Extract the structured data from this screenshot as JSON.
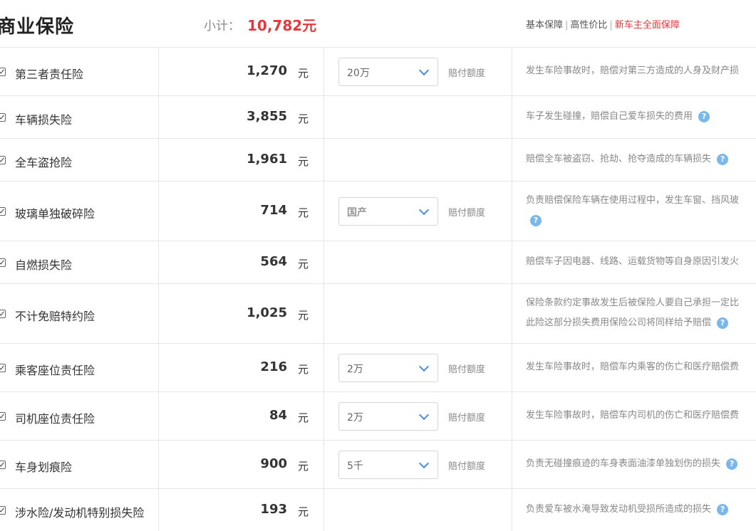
{
  "header": {
    "title": "商业保险",
    "subtotal_label": "小计：",
    "subtotal_value": "10,782元",
    "plans": [
      "基本保障",
      "高性价比",
      "新车主全面保障"
    ]
  },
  "common": {
    "currency": "元",
    "coverage_label": "赔付额度"
  },
  "rows": [
    {
      "name": "第三者责任险",
      "price": "1,270",
      "select": "20万",
      "desc_lines": [
        "发生车险事故时，赔偿对第三方造成的人身及财产损"
      ]
    },
    {
      "name": "车辆损失险",
      "price": "3,855",
      "desc_lines": [
        "车子发生碰撞，赔偿自己爱车损失的费用"
      ]
    },
    {
      "name": "全车盗抢险",
      "price": "1,961",
      "desc_lines": [
        "赔偿全车被盗窃、抢劫、抢夺造成的车辆损失"
      ]
    },
    {
      "name": "玻璃单独破碎险",
      "price": "714",
      "select": "国产",
      "desc_lines": [
        "负责赔偿保险车辆在使用过程中，发生车窗、挡风玻"
      ]
    },
    {
      "name": "自燃损失险",
      "price": "564",
      "desc_lines": [
        "赔偿车子因电器、线路、运载货物等自身原因引发火"
      ]
    },
    {
      "name": "不计免赔特约险",
      "price": "1,025",
      "desc_lines": [
        "保险条款约定事故发生后被保险人要自己承担一定比",
        "此险这部分损失费用保险公司将同样给予赔偿"
      ]
    },
    {
      "name": "乘客座位责任险",
      "price": "216",
      "select": "2万",
      "desc_lines": [
        "发生车险事故时，赔偿车内乘客的伤亡和医疗赔偿费"
      ]
    },
    {
      "name": "司机座位责任险",
      "price": "84",
      "select": "2万",
      "desc_lines": [
        "发生车险事故时，赔偿车内司机的伤亡和医疗赔偿费"
      ]
    },
    {
      "name": "车身划痕险",
      "price": "900",
      "select": "5千",
      "desc_lines": [
        "负责无碰撞痕迹的车身表面油漆单独划伤的损失"
      ]
    },
    {
      "name": "涉水险/发动机特别损失险",
      "price": "193",
      "desc_lines": [
        "负责爱车被水淹导致发动机受损所造成的损失"
      ]
    }
  ]
}
